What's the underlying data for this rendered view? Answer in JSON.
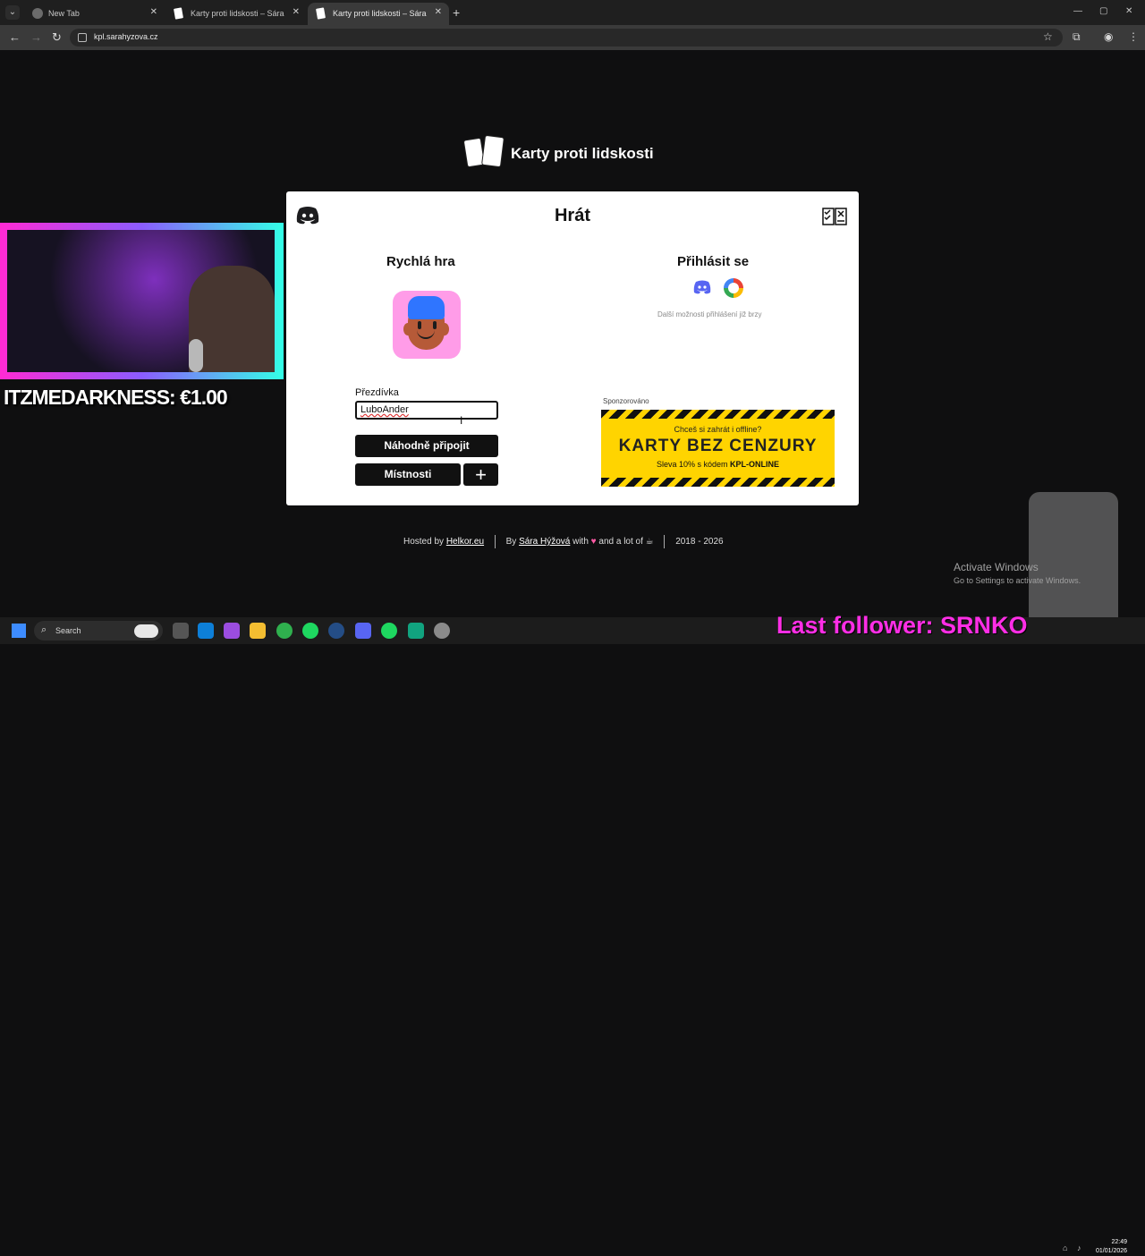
{
  "browser": {
    "tabs": [
      {
        "label": "New Tab"
      },
      {
        "label": "Karty proti lidskosti – Sára Hýž..."
      },
      {
        "label": "Karty proti lidskosti – Sára Hýž..."
      }
    ],
    "url": "kpl.sarahyzova.cz"
  },
  "page": {
    "brand": "Karty proti lidskosti",
    "panel_title": "Hrát",
    "quick_game": {
      "title": "Rychlá hra",
      "nickname_label": "Přezdívka",
      "nickname_value": "LuboAnder",
      "random_join_button": "Náhodně připojit",
      "rooms_button": "Místnosti",
      "add_room_button": "+"
    },
    "login": {
      "title": "Přihlásit se",
      "note": "Další možnosti přihlášení již brzy"
    },
    "sponsored": {
      "label": "Sponzorováno",
      "subtitle": "Chceš si zahrát i offline?",
      "title": "KARTY BEZ CENZURY",
      "discount_prefix": "Sleva 10% s kódem ",
      "code": "KPL-ONLINE"
    },
    "footer": {
      "hosted_by": "Hosted by ",
      "host": "Helkor.eu",
      "by": "By ",
      "author": "Sára Hýžová",
      "with": " with ",
      "love": "♥",
      "and": " and a lot of ",
      "coffee": "☕",
      "years": "2018 - 2026"
    }
  },
  "overlay": {
    "donation": "ITZMEDARKNESS: €1.00",
    "activate_title": "Activate Windows",
    "activate_subtitle": "Go to Settings to activate Windows.",
    "last_follower": "Last follower: SRNKO"
  },
  "taskbar": {
    "search_label": "Search",
    "time": "22:49",
    "date": "01/01/2026"
  },
  "colors": {
    "background": "#0f0f10",
    "panel": "#ffffff",
    "primary_button": "#111111",
    "ad_yellow": "#ffd400",
    "follower_magenta": "#ff2ee6",
    "discord": "#5865f2"
  },
  "icons": {
    "discord": "discord-icon",
    "rules": "rules-book-icon",
    "google": "google-icon",
    "windows": "windows-start-icon",
    "search": "search-icon"
  }
}
